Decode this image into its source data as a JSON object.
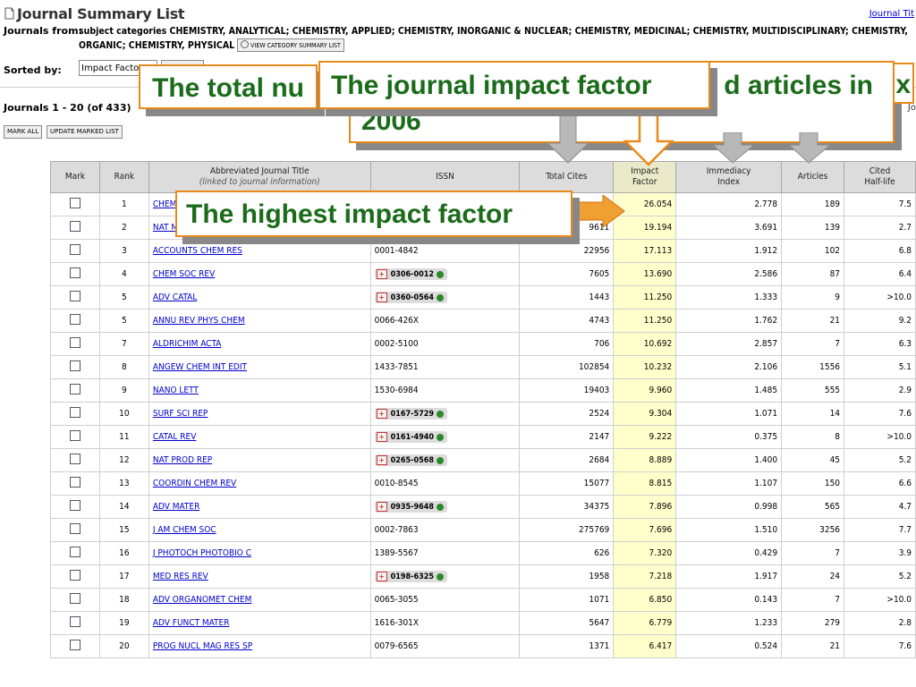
{
  "header": {
    "title": "Journal Summary List",
    "right_link": "Journal Tit",
    "journals_from_label": "Journals from:",
    "journals_from_text": "subject categories CHEMISTRY, ANALYTICAL; CHEMISTRY, APPLIED; CHEMISTRY, INORGANIC & NUCLEAR; CHEMISTRY, MEDICINAL; CHEMISTRY, MULTIDISCIPLINARY; CHEMISTRY, ORGANIC; CHEMISTRY, PHYSICAL",
    "view_category_button": "VIEW CATEGORY SUMMARY LIST",
    "sorted_by_label": "Sorted by:",
    "sorted_by_value": "Impact Factor",
    "journals_count": "Journals 1 - 20 (of 433)",
    "right_cut": "Jo",
    "mark_all": "MARK ALL",
    "update_marked": "UPDATE MARKED LIST"
  },
  "table": {
    "headers": {
      "mark": "Mark",
      "rank": "Rank",
      "title": "Abbreviated Journal Title",
      "title_sub": "(linked to journal information)",
      "issn": "ISSN",
      "total_cites": "Total Cites",
      "impact_factor_1": "Impact",
      "impact_factor_2": "Factor",
      "immediacy_1": "Immediacy",
      "immediacy_2": "Index",
      "articles": "Articles",
      "half_life_1": "Cited",
      "half_life_2": "Half-life"
    },
    "rows": [
      {
        "rank": "1",
        "title": "CHEM REV",
        "issn": "",
        "badge": false,
        "cites": "",
        "impact": "26.054",
        "immediacy": "2.778",
        "articles": "189",
        "half_life": "7.5"
      },
      {
        "rank": "2",
        "title": "NAT MATER",
        "issn": "",
        "badge": false,
        "cites": "9611",
        "impact": "19.194",
        "immediacy": "3.691",
        "articles": "139",
        "half_life": "2.7"
      },
      {
        "rank": "3",
        "title": "ACCOUNTS CHEM RES",
        "issn": "0001-4842",
        "badge": false,
        "cites": "22956",
        "impact": "17.113",
        "immediacy": "1.912",
        "articles": "102",
        "half_life": "6.8"
      },
      {
        "rank": "4",
        "title": "CHEM SOC REV",
        "issn": "0306-0012",
        "badge": true,
        "cites": "7605",
        "impact": "13.690",
        "immediacy": "2.586",
        "articles": "87",
        "half_life": "6.4"
      },
      {
        "rank": "5",
        "title": "ADV CATAL",
        "issn": "0360-0564",
        "badge": true,
        "cites": "1443",
        "impact": "11.250",
        "immediacy": "1.333",
        "articles": "9",
        "half_life": ">10.0"
      },
      {
        "rank": "5",
        "title": "ANNU REV PHYS CHEM",
        "issn": "0066-426X",
        "badge": false,
        "cites": "4743",
        "impact": "11.250",
        "immediacy": "1.762",
        "articles": "21",
        "half_life": "9.2"
      },
      {
        "rank": "7",
        "title": "ALDRICHIM ACTA",
        "issn": "0002-5100",
        "badge": false,
        "cites": "706",
        "impact": "10.692",
        "immediacy": "2.857",
        "articles": "7",
        "half_life": "6.3"
      },
      {
        "rank": "8",
        "title": "ANGEW CHEM INT EDIT",
        "issn": "1433-7851",
        "badge": false,
        "cites": "102854",
        "impact": "10.232",
        "immediacy": "2.106",
        "articles": "1556",
        "half_life": "5.1"
      },
      {
        "rank": "9",
        "title": "NANO LETT",
        "issn": "1530-6984",
        "badge": false,
        "cites": "19403",
        "impact": "9.960",
        "immediacy": "1.485",
        "articles": "555",
        "half_life": "2.9"
      },
      {
        "rank": "10",
        "title": "SURF SCI REP",
        "issn": "0167-5729",
        "badge": true,
        "cites": "2524",
        "impact": "9.304",
        "immediacy": "1.071",
        "articles": "14",
        "half_life": "7.6"
      },
      {
        "rank": "11",
        "title": "CATAL REV",
        "issn": "0161-4940",
        "badge": true,
        "cites": "2147",
        "impact": "9.222",
        "immediacy": "0.375",
        "articles": "8",
        "half_life": ">10.0"
      },
      {
        "rank": "12",
        "title": "NAT PROD REP",
        "issn": "0265-0568",
        "badge": true,
        "cites": "2684",
        "impact": "8.889",
        "immediacy": "1.400",
        "articles": "45",
        "half_life": "5.2"
      },
      {
        "rank": "13",
        "title": "COORDIN CHEM REV",
        "issn": "0010-8545",
        "badge": false,
        "cites": "15077",
        "impact": "8.815",
        "immediacy": "1.107",
        "articles": "150",
        "half_life": "6.6"
      },
      {
        "rank": "14",
        "title": "ADV MATER",
        "issn": "0935-9648",
        "badge": true,
        "cites": "34375",
        "impact": "7.896",
        "immediacy": "0.998",
        "articles": "565",
        "half_life": "4.7"
      },
      {
        "rank": "15",
        "title": "J AM CHEM SOC",
        "issn": "0002-7863",
        "badge": false,
        "cites": "275769",
        "impact": "7.696",
        "immediacy": "1.510",
        "articles": "3256",
        "half_life": "7.7"
      },
      {
        "rank": "16",
        "title": "J PHOTOCH PHOTOBIO C",
        "issn": "1389-5567",
        "badge": false,
        "cites": "626",
        "impact": "7.320",
        "immediacy": "0.429",
        "articles": "7",
        "half_life": "3.9"
      },
      {
        "rank": "17",
        "title": "MED RES REV",
        "issn": "0198-6325",
        "badge": true,
        "cites": "1958",
        "impact": "7.218",
        "immediacy": "1.917",
        "articles": "24",
        "half_life": "5.2"
      },
      {
        "rank": "18",
        "title": "ADV ORGANOMET CHEM",
        "issn": "0065-3055",
        "badge": false,
        "cites": "1071",
        "impact": "6.850",
        "immediacy": "0.143",
        "articles": "7",
        "half_life": ">10.0"
      },
      {
        "rank": "19",
        "title": "ADV FUNCT MATER",
        "issn": "1616-301X",
        "badge": false,
        "cites": "5647",
        "impact": "6.779",
        "immediacy": "1.233",
        "articles": "279",
        "half_life": "2.8"
      },
      {
        "rank": "20",
        "title": "PROG NUCL MAG RES SP",
        "issn": "0079-6565",
        "badge": false,
        "cites": "1371",
        "impact": "6.417",
        "immediacy": "0.524",
        "articles": "21",
        "half_life": "7.6"
      }
    ]
  },
  "callouts": {
    "total_cites": "The total nu",
    "impact_factor": "The journal impact factor",
    "articles_right": "d articles in",
    "articles_year": "2006",
    "articles_cut": "x",
    "highest": "The highest impact factor"
  },
  "colors": {
    "callout_border": "#e88a1a",
    "callout_text": "#1a6b1a",
    "impact_column_bg": "#ffffcc",
    "link": "#0000cc"
  }
}
